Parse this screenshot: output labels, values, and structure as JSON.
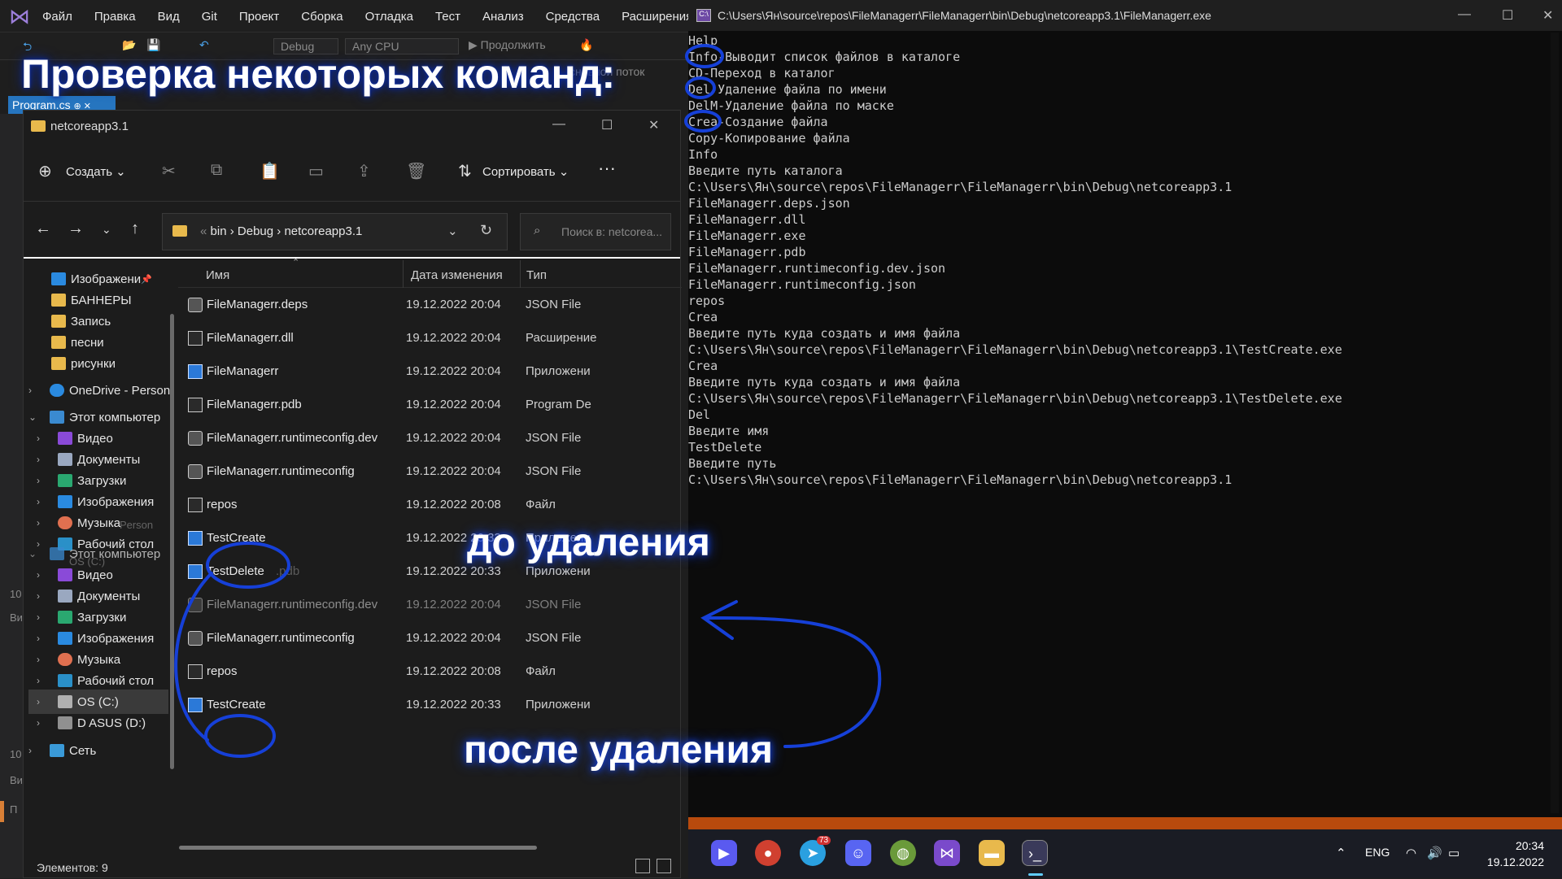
{
  "vs": {
    "menu": [
      "Файл",
      "Правка",
      "Вид",
      "Git",
      "Проект",
      "Сборка",
      "Отладка",
      "Тест",
      "Анализ",
      "Средства",
      "Расширения"
    ],
    "config": "Debug",
    "platform": "Any CPU",
    "continue": "Продолжить",
    "tab": "Program.cs",
    "line_numbers": [
      "10",
      "10"
    ],
    "side_labels": [
      "Ви",
      "Ви",
      "П"
    ],
    "bg_text": "сновной поток"
  },
  "overlay": {
    "title": "Проверка некоторых команд:",
    "before": "до удаления",
    "after": "после удаления"
  },
  "explorer": {
    "title": "netcoreapp3.1",
    "create": "Создать",
    "sort": "Сортировать",
    "crumbs": [
      "bin",
      "Debug",
      "netcoreapp3.1"
    ],
    "search_placeholder": "Поиск в: netcorea...",
    "status": "Элементов: 9",
    "nav": [
      {
        "label": "Изображени",
        "pin": "📌"
      },
      {
        "label": "БАННЕРЫ"
      },
      {
        "label": "Запись"
      },
      {
        "label": "песни"
      },
      {
        "label": "рисунки"
      },
      {
        "label": "OneDrive - Person"
      },
      {
        "label": "Этот компьютер"
      },
      {
        "label": "Видео"
      },
      {
        "label": "Документы"
      },
      {
        "label": "Загрузки"
      },
      {
        "label": "Изображения"
      },
      {
        "label": "Музыка"
      },
      {
        "label": "Рабочий стол"
      },
      {
        "label": "Этот компьютер"
      },
      {
        "label": "Видео"
      },
      {
        "label": "Документы"
      },
      {
        "label": "Загрузки"
      },
      {
        "label": "Изображения"
      },
      {
        "label": "Музыка"
      },
      {
        "label": "Рабочий стол"
      },
      {
        "label": "OS (C:)"
      },
      {
        "label": "D ASUS (D:)"
      },
      {
        "label": "Сеть"
      }
    ],
    "nav_ghost": [
      "- Person",
      "OS (C:)"
    ],
    "columns": [
      "Имя",
      "Дата изменения",
      "Тип"
    ],
    "files": [
      {
        "name": "FileManagerr.deps",
        "date": "19.12.2022 20:04",
        "type": "JSON File",
        "icon": "json"
      },
      {
        "name": "FileManagerr.dll",
        "date": "19.12.2022 20:04",
        "type": "Расширение",
        "icon": "file"
      },
      {
        "name": "FileManagerr",
        "date": "19.12.2022 20:04",
        "type": "Приложени",
        "icon": "app"
      },
      {
        "name": "FileManagerr.pdb",
        "date": "19.12.2022 20:04",
        "type": "Program De",
        "icon": "file"
      },
      {
        "name": "FileManagerr.runtimeconfig.dev",
        "date": "19.12.2022 20:04",
        "type": "JSON File",
        "icon": "json"
      },
      {
        "name": "FileManagerr.runtimeconfig",
        "date": "19.12.2022 20:04",
        "type": "JSON File",
        "icon": "json"
      },
      {
        "name": "repos",
        "date": "19.12.2022 20:08",
        "type": "Файл",
        "icon": "file"
      },
      {
        "name": "TestCreate",
        "date": "19.12.2022 20:33",
        "type": "Приложени",
        "icon": "app"
      },
      {
        "name": "TestDelete",
        "date": "19.12.2022 20:33",
        "type": "Приложени",
        "icon": "app"
      },
      {
        "name": "FileManagerr.runtimeconfig.dev",
        "date": "19.12.2022 20:04",
        "type": "JSON File",
        "icon": "json"
      },
      {
        "name": "FileManagerr.runtimeconfig",
        "date": "19.12.2022 20:04",
        "type": "JSON File",
        "icon": "json"
      },
      {
        "name": "repos",
        "date": "19.12.2022 20:08",
        "type": "Файл",
        "icon": "file"
      },
      {
        "name": "TestCreate",
        "date": "19.12.2022 20:33",
        "type": "Приложени",
        "icon": "app"
      }
    ],
    "ghost_name": ".pdb"
  },
  "terminal": {
    "title": "C:\\Users\\Ян\\source\\repos\\FileManagerr\\FileManagerr\\bin\\Debug\\netcoreapp3.1\\FileManagerr.exe",
    "lines": [
      "Help",
      "Info-Выводит список файлов в каталоге",
      "CD-Переход в каталог",
      "Del-Удаление файла по имени",
      "DelM-Удаление файла по маске",
      "Crea-Создание файла",
      "Copy-Копирование файла",
      "Info",
      "Введите путь каталога",
      "C:\\Users\\Ян\\source\\repos\\FileManagerr\\FileManagerr\\bin\\Debug\\netcoreapp3.1",
      "FileManagerr.deps.json",
      "FileManagerr.dll",
      "FileManagerr.exe",
      "FileManagerr.pdb",
      "FileManagerr.runtimeconfig.dev.json",
      "FileManagerr.runtimeconfig.json",
      "repos",
      "Crea",
      "Введите путь куда создать и имя файла",
      "C:\\Users\\Ян\\source\\repos\\FileManagerr\\FileManagerr\\bin\\Debug\\netcoreapp3.1\\TestCreate.exe",
      "Crea",
      "Введите путь куда создать и имя файла",
      "C:\\Users\\Ян\\source\\repos\\FileManagerr\\FileManagerr\\bin\\Debug\\netcoreapp3.1\\TestDelete.exe",
      "Del",
      "Введите имя",
      "TestDelete",
      "Введите путь",
      "C:\\Users\\Ян\\source\\repos\\FileManagerr\\FileManagerr\\bin\\Debug\\netcoreapp3.1"
    ]
  },
  "taskbar": {
    "lang": "ENG",
    "time": "20:34",
    "date": "19.12.2022",
    "telegram_badge": "73"
  },
  "colors": {
    "ink": "#1640d8",
    "accent": "#2675bf",
    "terminal_bg": "#0c0c0c"
  }
}
